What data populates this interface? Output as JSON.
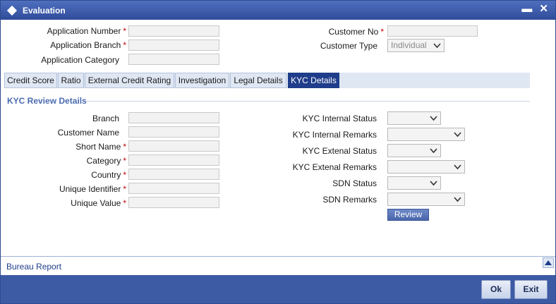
{
  "window": {
    "title": "Evaluation",
    "minimize_symbol": "▬",
    "close_symbol": "✕"
  },
  "header": {
    "application_number_label": "Application Number",
    "application_branch_label": "Application Branch",
    "application_category_label": "Application Category",
    "customer_no_label": "Customer No",
    "customer_type_label": "Customer Type",
    "customer_type_value": "Individual",
    "required_marker": "*"
  },
  "tabs": [
    {
      "label": "Credit Score"
    },
    {
      "label": "Ratio"
    },
    {
      "label": "External Credit Rating"
    },
    {
      "label": "Investigation"
    },
    {
      "label": "Legal Details"
    },
    {
      "label": "KYC Details"
    }
  ],
  "active_tab": "KYC Details",
  "kyc": {
    "section_title": "KYC Review Details",
    "branch_label": "Branch",
    "customer_name_label": "Customer Name",
    "short_name_label": "Short Name",
    "category_label": "Category",
    "country_label": "Country",
    "unique_identifier_label": "Unique Identifier",
    "unique_value_label": "Unique Value",
    "internal_status_label": "KYC Internal Status",
    "internal_remarks_label": "KYC Internal Remarks",
    "extenal_status_label": "KYC Extenal Status",
    "extenal_remarks_label": "KYC Extenal Remarks",
    "sdn_status_label": "SDN Status",
    "sdn_remarks_label": "SDN Remarks",
    "review_button": "Review"
  },
  "bottom": {
    "bureau_report": "Bureau Report",
    "ok_button": "Ok",
    "exit_button": "Exit"
  },
  "colors": {
    "titlebar": "#2f4c99",
    "active_tab": "#1f3d8a",
    "section_title": "#4a6bb0",
    "required": "#c00000",
    "footer": "#3d5aa4"
  }
}
